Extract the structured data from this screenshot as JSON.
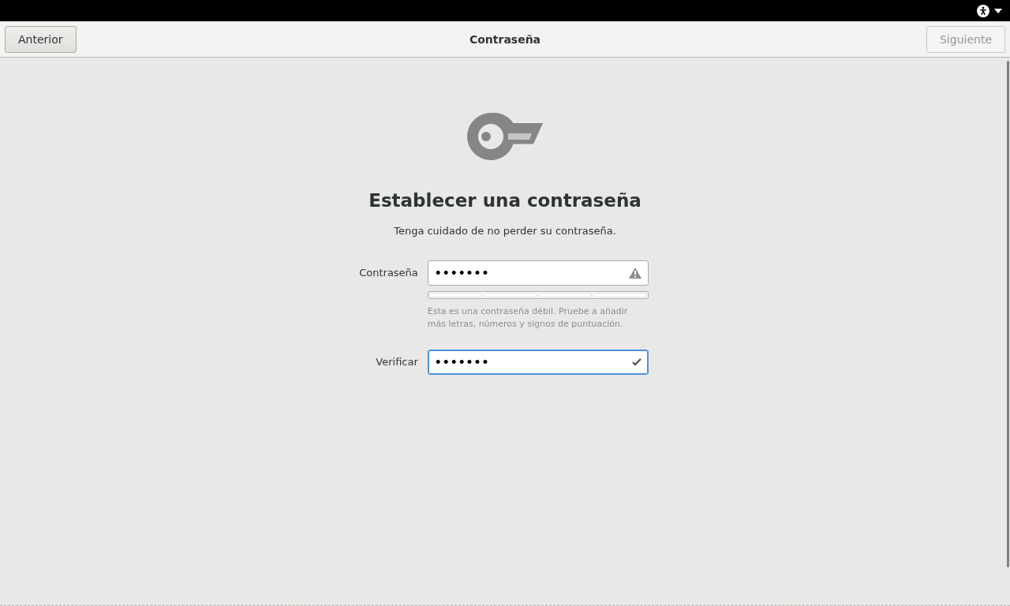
{
  "header": {
    "back_button": {
      "label": "Anterior",
      "disabled": false
    },
    "title": "Contraseña",
    "next_button": {
      "label": "Siguiente",
      "disabled": true
    }
  },
  "page": {
    "heading": "Establecer una contraseña",
    "subtitle": "Tenga cuidado de no perder su contraseña.",
    "fields": [
      {
        "label": "Contraseña",
        "value": "•••••••",
        "kind": "warning",
        "focused": false,
        "hint": "Esta es una contraseña débil. Pruebe a añadir más letras, números y signos de puntuación."
      },
      {
        "label": "Verificar",
        "value": "•••••••",
        "kind": "ok",
        "focused": true
      }
    ]
  }
}
